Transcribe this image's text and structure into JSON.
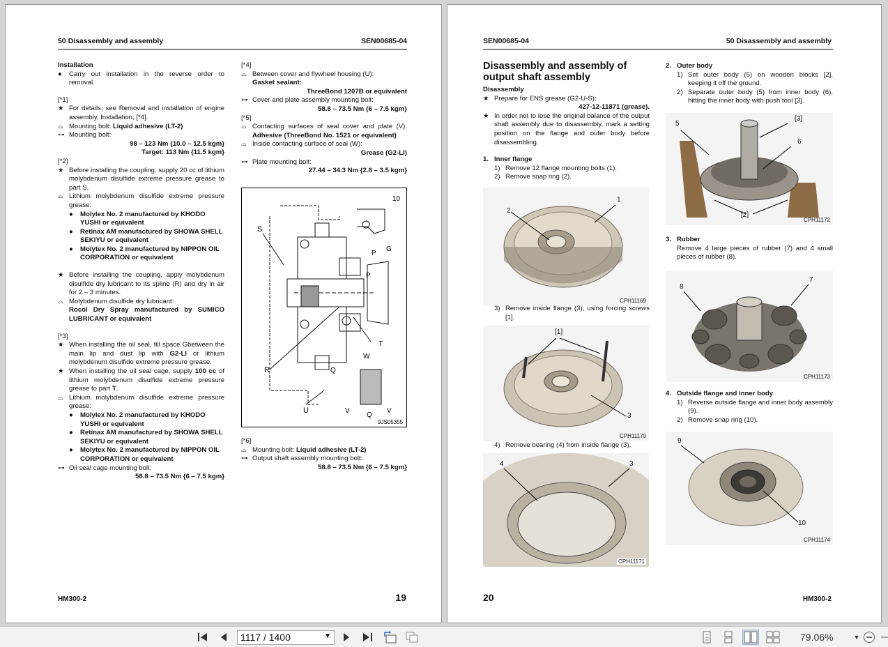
{
  "left_page": {
    "header_left": "50 Disassembly and assembly",
    "header_right": "SEN00685-04",
    "footer_model": "HM300-2",
    "footer_page": "19",
    "col1": {
      "installation_title": "Installation",
      "installation_text": "Carry out installation in the reverse order to removal.",
      "n1_label": "[*1]",
      "n1_text": "For details, see Removal and installation of engine assembly, Installation, [*4].",
      "n1_adhesive_label": "Mounting bolt: ",
      "n1_adhesive_value": "Liquid adhesive (LT-2)",
      "n1_torque_label": "Mounting bolt:",
      "n1_torque_value": "98 – 123 Nm {10.0 – 12.5 kgm}",
      "n1_target": "Target: 113 Nm {11.5 kgm}",
      "n2_label": "[*2]",
      "n2_text": "Before installing the coupling, supply 20 cc of lithium molybdenum disulfide extreme pressure grease to part S.",
      "n2_grease_label": "Lithium molybdenum disulfide extreme pressure grease:",
      "n2_opt1": "Molylex No. 2 manufactured by KHODO YUSHI or equivalent",
      "n2_opt2": "Retinax AM manufactured by SHOWA SHELL SEKIYU or equivalent",
      "n2_opt3": "Molytex No. 2 manufactured by NIPPON OIL CORPORATION or equivalent",
      "n2_text2": "Before installing the coupling, apply molybdenum disulfide dry lubricant to its spline (R) and dry in air for 2 – 3 minutes.",
      "n2_lub_label": "Molybdenum disulfide dry lubricant:",
      "n2_lub_value": "Rocol Dry Spray manufactured by SUMICO LUBRICANT or equivalent",
      "n3_label": "[*3]",
      "n3_text1a": "When installing the oil seal, fill space Gbetween the main lip and dust lip with ",
      "n3_text1b": "G2-LI",
      "n3_text1c": " or lithium molybdenum disulfide extreme pressure grease.",
      "n3_text2a": "When installing the oil seal cage, supply ",
      "n3_text2b": "100 cc",
      "n3_text2c": " of lithium molybdenum disulfide extreme pressure grease to part ",
      "n3_text2d": "T",
      "n3_grease_label": "Lithium molybdenum disulfide extreme pressure grease:",
      "n3_opt1": "Molylex No. 2 manufactured by KHODO YUSHI or equivalent",
      "n3_opt2": "Retinax AM manufactured by SHOWA SHELL SEKIYU or equivalent",
      "n3_opt3": "Molytex No. 2 manufactured by NIPPON OIL CORPORATION or equivalent",
      "n3_torque_label": "Oil seal cage mounting bolt:",
      "n3_torque_value": "58.8 – 73.5 Nm {6 – 7.5 kgm}"
    },
    "col2": {
      "n4_label": "[*4]",
      "n4_sealant_label": "Between cover and flywheel housing (U):",
      "n4_sealant_name": "Gasket sealant:",
      "n4_sealant_value": "ThreeBond 1207B or equivalent",
      "n4_torque_label": "Cover and plate assembly mounting bolt:",
      "n4_torque_value": "58.8 – 73.5 Nm {6 – 7.5 kgm}",
      "n5_label": "[*5]",
      "n5_adh_text_a": "Contacting surfaces of seal cover and plate (V): ",
      "n5_adh_text_b": "Adhesive (ThreeBond No. 1521 or equivalent)",
      "n5_grease_label": "Inside contacting surface of seal (W):",
      "n5_grease_value": "Grease (G2-LI)",
      "n5_torque_label": "Plate mounting bolt:",
      "n5_torque_value": "27.44 – 34.3 Nm {2.8 – 3.5 kgm}",
      "figure_id": "9JS05355",
      "fig_labels": {
        "s": "S",
        "r": "R",
        "u": "U",
        "q": "Q",
        "t": "T",
        "p1": "P",
        "p2": "P",
        "g": "G",
        "w": "W",
        "v1": "V",
        "v2": "V",
        "q2": "Q",
        "ten": "10"
      },
      "n6_label": "[*6]",
      "n6_adh_label": "Mounting bolt: ",
      "n6_adh_value": "Liquid adhesive (LT-2)",
      "n6_torque_label": "Output shaft assembly mounting bolt:",
      "n6_torque_value": "58.8 – 73.5 Nm {6 – 7.5 kgm}"
    }
  },
  "right_page": {
    "header_left": "SEN00685-04",
    "header_right": "50 Disassembly and assembly",
    "footer_page": "20",
    "footer_model": "HM300-2",
    "title": "Disassembly and assembly of output shaft assembly",
    "disassembly_title": "Disassembly",
    "prep_text": "Prepare for ENS grease (G2-U-S):",
    "prep_part": "427-12-11871 (grease).",
    "balance_text": "In order not to lose the original balance of the output shaft assembly due to disassembly, mark a setting position on the flange and outer body before disassembling.",
    "s1_title": "Inner flange",
    "s1_step1": "Remove 12 flange mounting bolts (1).",
    "s1_step2": "Remove snap ring (2).",
    "s1_step3": "Remove inside flange (3), using forcing screws [1].",
    "s1_step4": "Remove bearing (4) from inside flange (3).",
    "s2_title": "Outer body",
    "s2_step1": "Set outer body (5) on wooden blocks [2], keeping it off the ground.",
    "s2_step2": "Separate outer body (5) from inner body (6), hitting the inner body with push tool [3].",
    "s3_title": "Rubber",
    "s3_text": "Remove 4 large pieces of rubber (7) and 4 small pieces of rubber (8).",
    "s4_title": "Outside flange and inner body",
    "s4_step1": "Reverse outside flange and inner body assembly (9).",
    "s4_step2": "Remove snap ring (10).",
    "photos": {
      "p1": "CPH11169",
      "p2": "CPH11170",
      "p3": "CPH11171",
      "p4": "CPH11172",
      "p5": "CPH11173",
      "p6": "CPH11174"
    },
    "callouts": {
      "c1": "1",
      "c2": "2",
      "c3": "3",
      "c4": "4",
      "c5": "5",
      "c6": "6",
      "c7": "7",
      "c8": "8",
      "c9": "9",
      "c10": "10",
      "b1": "[1]",
      "b2": "[2]",
      "b3": "[3]"
    }
  },
  "toolbar": {
    "page_field": "1117 / 1400",
    "zoom": "79.06%"
  },
  "icons": {
    "first": "first-page-icon",
    "prev": "prev-page-icon",
    "next": "next-page-icon",
    "last": "last-page-icon"
  }
}
